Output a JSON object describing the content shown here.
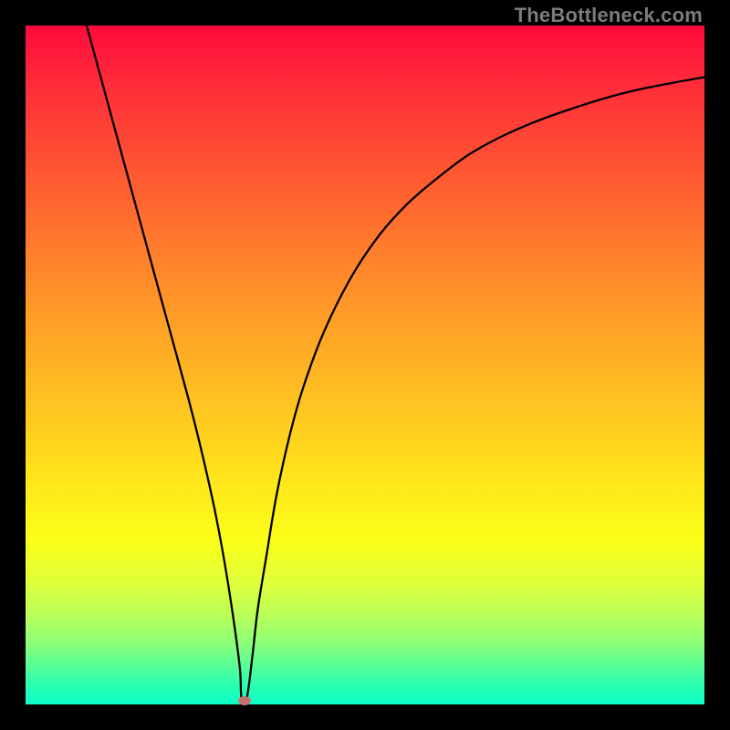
{
  "watermark": "TheBottleneck.com",
  "chart_data": {
    "type": "line",
    "title": "",
    "xlabel": "",
    "ylabel": "",
    "xlim": [
      0,
      100
    ],
    "ylim": [
      0,
      100
    ],
    "x": [
      9,
      12,
      15,
      18,
      21,
      24,
      26,
      28,
      29.8,
      31.5,
      31.8,
      32.6,
      33.4,
      34.2,
      35.5,
      37,
      39,
      41,
      44,
      48,
      52,
      56,
      60,
      65,
      70,
      75,
      80,
      85,
      90,
      95,
      100
    ],
    "y": [
      100,
      89,
      78,
      67,
      56,
      45,
      37,
      28,
      18,
      6,
      1,
      1,
      7,
      14,
      22,
      31,
      40,
      47,
      55,
      63,
      69,
      73.5,
      77,
      80.8,
      83.6,
      85.8,
      87.6,
      89.2,
      90.5,
      91.5,
      92.4
    ],
    "marker": {
      "x": 32.2,
      "y": 0.5
    },
    "background_gradient": {
      "top": "#ff0a3c",
      "middle": "#ffe81b",
      "bottom": "#0affc8"
    }
  }
}
